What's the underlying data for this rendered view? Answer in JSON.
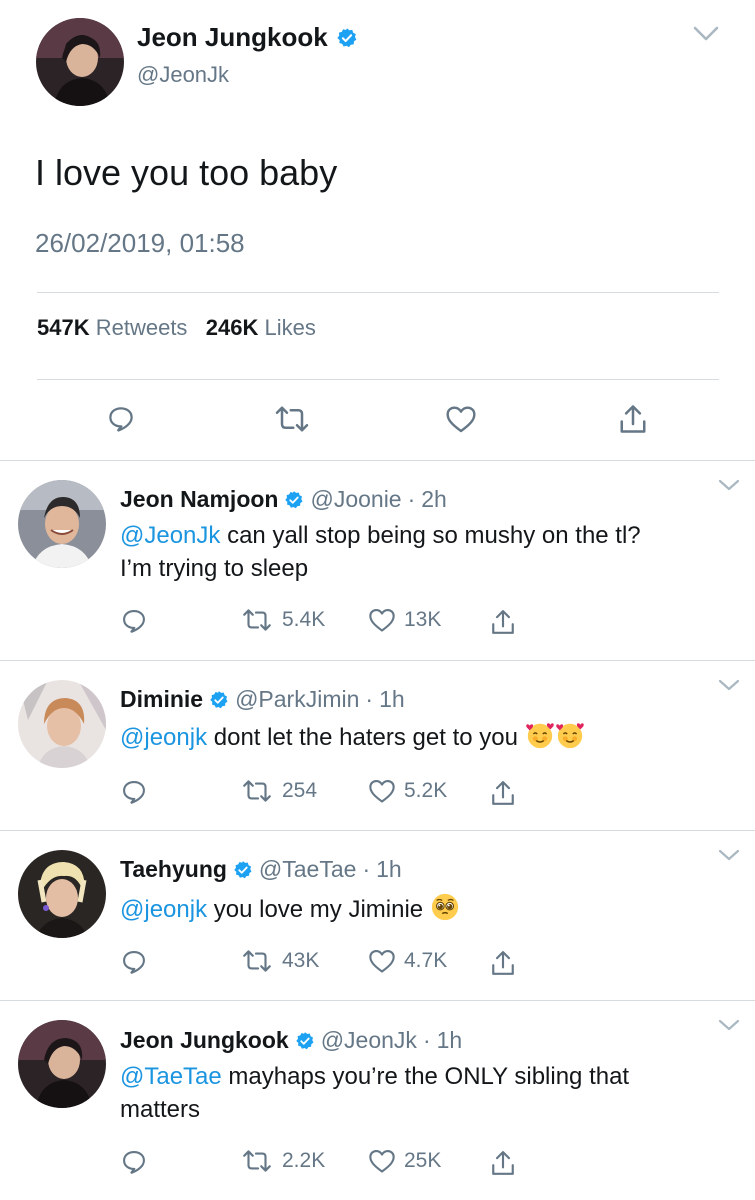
{
  "main_tweet": {
    "author_name": "Jeon Jungkook",
    "author_handle": "@JeonJk",
    "text": "I love you too baby",
    "timestamp": "26/02/2019, 01:58",
    "retweets_count": "547K",
    "retweets_label": "Retweets",
    "likes_count": "246K",
    "likes_label": "Likes",
    "verified": true
  },
  "colors": {
    "accent": "#1b95e0",
    "verified": "#1da1f2",
    "secondary_text": "#657786",
    "divider": "#d6dbe0"
  },
  "replies": [
    {
      "author_name": "Jeon Namjoon",
      "author_handle": "@Joonie",
      "time": "2h",
      "mention": "@JeonJk",
      "text_line1": " can yall stop being so mushy on the tl?",
      "text_line2": "I’m trying to sleep",
      "retweets": "5.4K",
      "likes": "13K"
    },
    {
      "author_name": "Diminie",
      "author_handle": "@ParkJimin",
      "time": "1h",
      "mention": "@jeonjk",
      "text_line1": " dont let the haters get to you ",
      "emojis": [
        "smiling-face-with-hearts",
        "smiling-face-with-hearts"
      ],
      "retweets": "254",
      "likes": "5.2K"
    },
    {
      "author_name": "Taehyung",
      "author_handle": "@TaeTae",
      "time": "1h",
      "mention": "@jeonjk",
      "text_line1": " you love my Jiminie ",
      "emojis": [
        "pleading-face"
      ],
      "retweets": "43K",
      "likes": "4.7K"
    },
    {
      "author_name": "Jeon Jungkook",
      "author_handle": "@JeonJk",
      "time": "1h",
      "mention": "@TaeTae",
      "text_line1": " mayhaps you’re the ONLY sibling that",
      "text_line2": "matters",
      "retweets": "2.2K",
      "likes": "25K"
    }
  ],
  "separator": "·"
}
